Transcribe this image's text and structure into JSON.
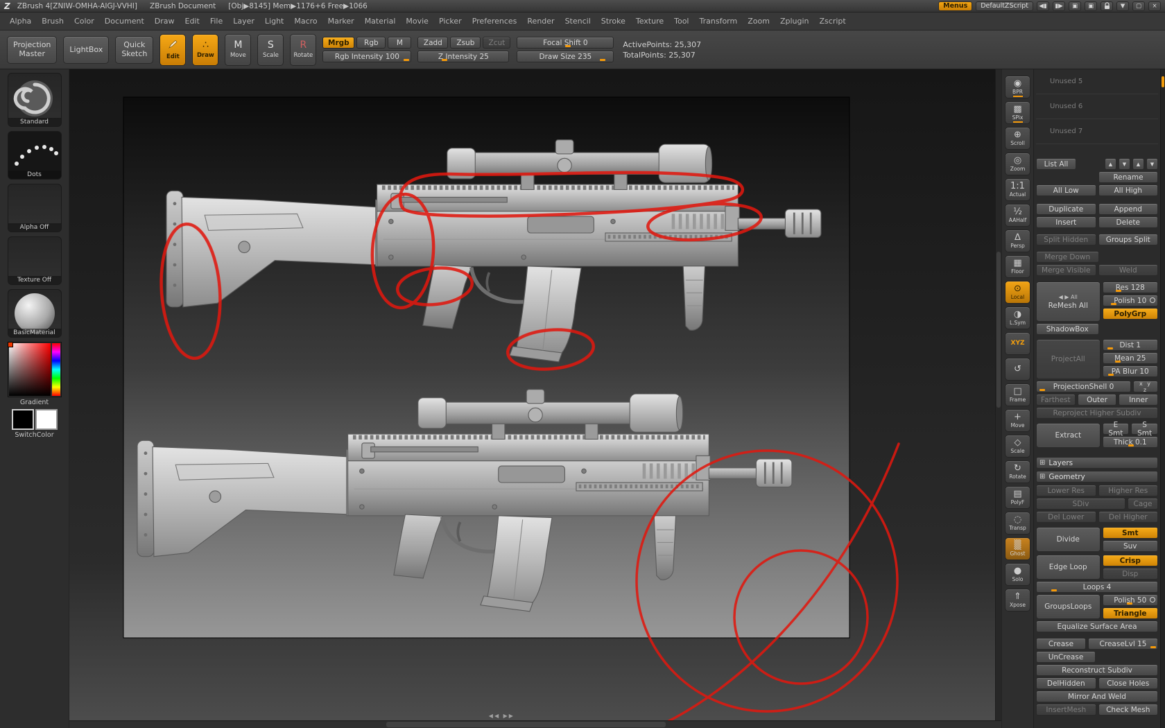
{
  "colors": {
    "accent": "#f09a0b",
    "annotation": "#e0190f"
  },
  "titlebar": {
    "app_title": "ZBrush 4[ZNIW-OMHA-AIGJ-VVHI]",
    "doc_title": "ZBrush Document",
    "stats": "[Obj▶8145]  Mem▶1176+6  Free▶1066",
    "menus": "Menus",
    "zscript": "DefaultZScript",
    "icons": [
      "◀▮",
      "▮▶",
      "▣",
      "▣",
      "▼",
      "▢",
      "×"
    ]
  },
  "menubar": {
    "items": [
      "Alpha",
      "Brush",
      "Color",
      "Document",
      "Draw",
      "Edit",
      "File",
      "Layer",
      "Light",
      "Macro",
      "Marker",
      "Material",
      "Movie",
      "Picker",
      "Preferences",
      "Render",
      "Stencil",
      "Stroke",
      "Texture",
      "Tool",
      "Transform",
      "Zoom",
      "Zplugin",
      "Zscript"
    ]
  },
  "shelf": {
    "projection_master": "Projection\nMaster",
    "lightbox": "LightBox",
    "quick_sketch": "Quick\nSketch",
    "edit": "Edit",
    "draw": "Draw",
    "move": "Move",
    "scale": "Scale",
    "rotate": "Rotate",
    "edit_icon": "✎",
    "draw_icon": "∴",
    "move_icon": "M",
    "scale_icon": "S",
    "rotate_icon": "R",
    "mrgb": "Mrgb",
    "rgb": "Rgb",
    "m": "M",
    "rgb_intensity": "Rgb Intensity 100",
    "zadd": "Zadd",
    "zsub": "Zsub",
    "zcut": "Zcut",
    "z_intensity": "Z Intensity 25",
    "focal_shift": "Focal Shift 0",
    "draw_size": "Draw Size 235",
    "active_points": "ActivePoints: 25,307",
    "total_points": "TotalPoints: 25,307"
  },
  "left_tray": {
    "standard": "Standard",
    "dots": "Dots",
    "alpha_off": "Alpha Off",
    "texture_off": "Texture Off",
    "basic_material": "BasicMaterial",
    "gradient": "Gradient",
    "switch_color": "SwitchColor"
  },
  "right_shelf": {
    "items": [
      {
        "label": "BPR",
        "glyph": "◉"
      },
      {
        "label": "SPix",
        "glyph": "▩"
      },
      {
        "label": "Scroll",
        "glyph": "⊕"
      },
      {
        "label": "Zoom",
        "glyph": "◎"
      },
      {
        "label": "Actual",
        "glyph": "1:1"
      },
      {
        "label": "AAHalf",
        "glyph": "½"
      },
      {
        "label": "Persp",
        "glyph": "∆"
      },
      {
        "label": "Floor",
        "glyph": "▦"
      },
      {
        "label": "Local",
        "glyph": "⊙"
      },
      {
        "label": "L.Sym",
        "glyph": "◑"
      },
      {
        "label": "XYZ",
        "glyph": ""
      },
      {
        "label": "",
        "glyph": "↺"
      },
      {
        "label": "Frame",
        "glyph": "□"
      },
      {
        "label": "Move",
        "glyph": "+"
      },
      {
        "label": "Scale",
        "glyph": "◇"
      },
      {
        "label": "Rotate",
        "glyph": "↻"
      },
      {
        "label": "PolyF",
        "glyph": "▤"
      },
      {
        "label": "Transp",
        "glyph": "◌"
      },
      {
        "label": "Ghost",
        "glyph": "▒"
      },
      {
        "label": "Solo",
        "glyph": "●"
      },
      {
        "label": "Xpose",
        "glyph": "⇑"
      }
    ]
  },
  "canvas": {
    "bottom_handle": "◀◀  ▶▶"
  },
  "tool": {
    "unused": [
      "Unused 5",
      "Unused 6",
      "Unused 7"
    ],
    "list_all": "List All",
    "arrows": [
      "▲",
      "▼",
      "▲",
      "▼"
    ],
    "rename": "Rename",
    "all_low": "All Low",
    "all_high": "All High",
    "duplicate": "Duplicate",
    "append": "Append",
    "insert": "Insert",
    "delete": "Delete",
    "split_hidden": "Split Hidden",
    "groups_split": "Groups Split",
    "merge_down": "Merge Down",
    "merge_visible": "Merge Visible",
    "weld": "Weld",
    "remesh_sym": "◀ ▶  All",
    "remesh_all": "ReMesh All",
    "res": "Res 128",
    "polish": "Polish 10",
    "polygrp": "PolyGrp",
    "shadowbox": "ShadowBox",
    "projectall": "ProjectAll",
    "dist": "Dist 1",
    "mean": "Mean 25",
    "pa_blur": "PA Blur 10",
    "projection_shell": "ProjectionShell 0",
    "axis_mini": "x y z",
    "farthest": "Farthest",
    "outer": "Outer",
    "inner": "Inner",
    "reproject": "Reproject Higher Subdiv",
    "extract": "Extract",
    "e_smt": "E Smt",
    "s_smt": "S Smt",
    "thick": "Thick 0.1",
    "layers": "Layers",
    "geometry": "Geometry",
    "lower_res": "Lower Res",
    "higher_res": "Higher Res",
    "sdiv": "SDiv",
    "cage": "Cage",
    "del_lower": "Del Lower",
    "del_higher": "Del Higher",
    "divide": "Divide",
    "smt": "Smt",
    "suv": "Suv",
    "edge_loop": "Edge Loop",
    "crisp": "Crisp",
    "disp": "Disp",
    "loops": "Loops 4",
    "groups_loops": "GroupsLoops",
    "polish50": "Polish 50",
    "triangle": "Triangle",
    "equalize": "Equalize Surface Area",
    "crease": "Crease",
    "crease_lvl": "CreaseLvl 15",
    "uncrease": "UnCrease",
    "reconstruct": "Reconstruct Subdiv",
    "delhidden": "DelHidden",
    "close_holes": "Close Holes",
    "mirror_weld": "Mirror And Weld",
    "insert_mesh": "InsertMesh",
    "check_mesh": "Check Mesh"
  }
}
